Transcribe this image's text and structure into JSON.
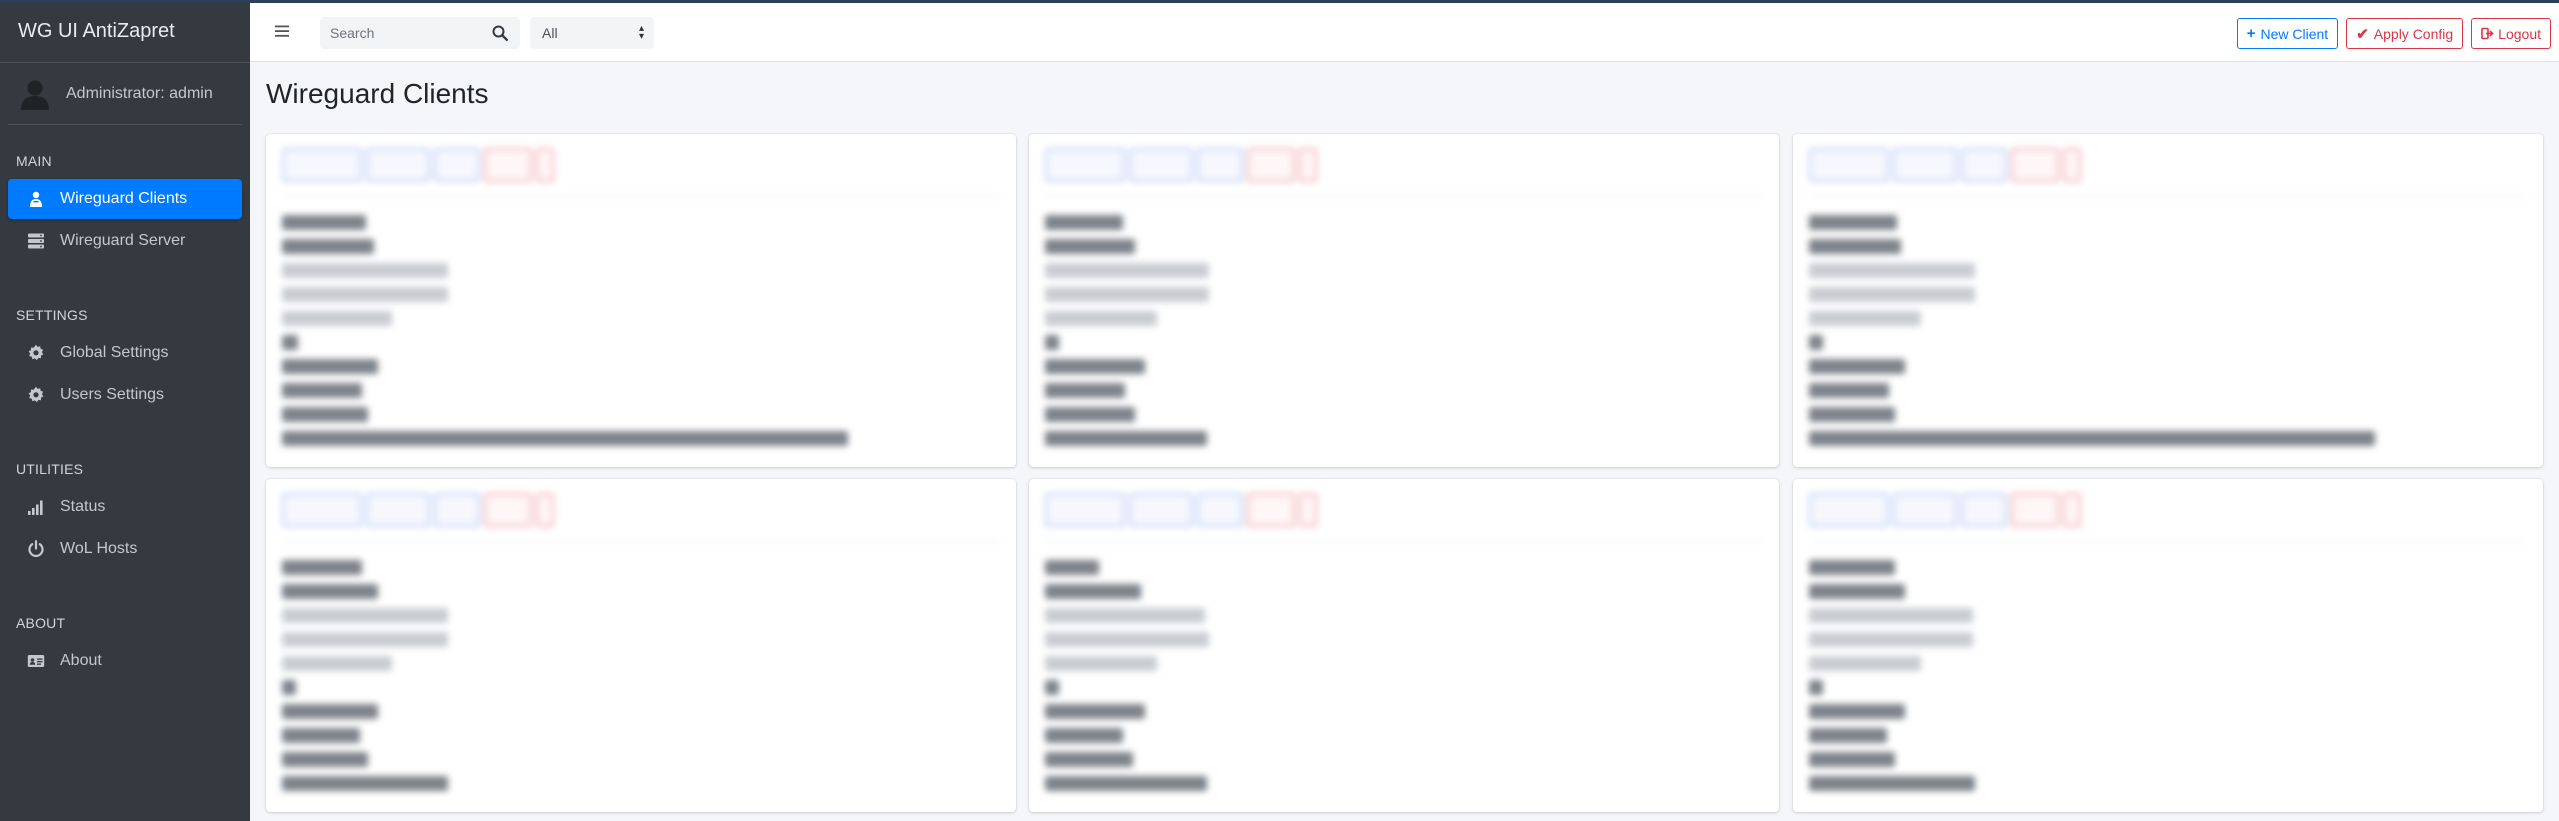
{
  "app": {
    "title": "WG UI AntiZapret"
  },
  "user": {
    "label": "Administrator: admin"
  },
  "sidebar": {
    "sections": [
      {
        "header": "MAIN",
        "items": [
          {
            "label": "Wireguard Clients",
            "icon": "users-icon",
            "active": true
          },
          {
            "label": "Wireguard Server",
            "icon": "server-icon",
            "active": false
          }
        ]
      },
      {
        "header": "SETTINGS",
        "items": [
          {
            "label": "Global Settings",
            "icon": "gear-icon",
            "active": false
          },
          {
            "label": "Users Settings",
            "icon": "gear-icon",
            "active": false
          }
        ]
      },
      {
        "header": "UTILITIES",
        "items": [
          {
            "label": "Status",
            "icon": "signal-icon",
            "active": false
          },
          {
            "label": "WoL Hosts",
            "icon": "power-icon",
            "active": false
          }
        ]
      },
      {
        "header": "ABOUT",
        "items": [
          {
            "label": "About",
            "icon": "id-card-icon",
            "active": false
          }
        ]
      }
    ]
  },
  "navbar": {
    "search_placeholder": "Search",
    "filter_value": "All",
    "new_client_label": "New Client",
    "apply_config_label": "Apply Config",
    "logout_label": "Logout"
  },
  "main": {
    "title": "Wireguard Clients"
  },
  "colors": {
    "sidebar_bg": "#343a40",
    "active_item": "#007bff",
    "primary": "#007bff",
    "danger": "#dc3545",
    "content_bg": "#f4f6f9"
  }
}
